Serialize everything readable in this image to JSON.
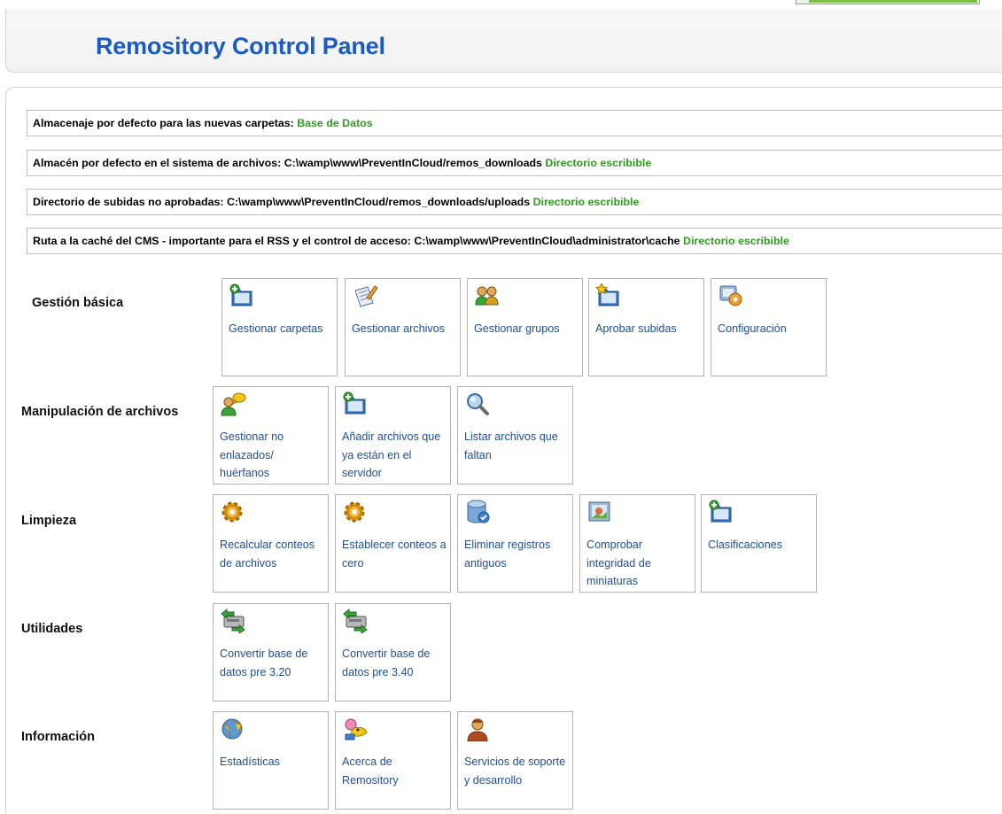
{
  "header": {
    "title": "Remository Control Panel"
  },
  "info": [
    {
      "label": "Almacenaje por defecto para las nuevas carpetas:",
      "value": "Base de Datos",
      "status": ""
    },
    {
      "label": "Almacén por defecto en el sistema de archivos:",
      "value": "C:\\wamp\\www\\PreventInCloud/remos_downloads",
      "status": "Directorio escribible"
    },
    {
      "label": "Directorio de subidas no aprobadas:",
      "value": "C:\\wamp\\www\\PreventInCloud/remos_downloads/uploads",
      "status": "Directorio escribible"
    },
    {
      "label": "Ruta a la caché del CMS - importante para el RSS y el control de acceso:",
      "value": "C:\\wamp\\www\\PreventInCloud\\administrator\\cache",
      "status": "Directorio escribible"
    }
  ],
  "colors": {
    "title": "#1a5cc4",
    "link": "#1f4f99",
    "ok": "#2f9e1f",
    "border": "#b3b3b3"
  },
  "sections": [
    {
      "label": "Gestión básica",
      "items": [
        {
          "label": "Gestionar carpetas",
          "icon": "folder-add-icon"
        },
        {
          "label": "Gestionar archivos",
          "icon": "document-edit-icon"
        },
        {
          "label": "Gestionar grupos",
          "icon": "users-icon"
        },
        {
          "label": "Aprobar subidas",
          "icon": "folder-star-icon"
        },
        {
          "label": "Configuración",
          "icon": "config-icon"
        }
      ]
    },
    {
      "label": "Manipulación de archivos",
      "items": [
        {
          "label": "Gestionar no enlazados/ huérfanos",
          "icon": "user-chat-icon"
        },
        {
          "label": "Añadir archivos que ya están en el servidor",
          "icon": "folder-add-icon"
        },
        {
          "label": "Listar archivos que faltan",
          "icon": "magnifier-icon"
        }
      ]
    },
    {
      "label": "Limpieza",
      "items": [
        {
          "label": "Recalcular conteos de archivos",
          "icon": "gear-icon"
        },
        {
          "label": "Establecer conteos a cero",
          "icon": "gear-icon"
        },
        {
          "label": "Eliminar registros antiguos",
          "icon": "database-icon"
        },
        {
          "label": "Comprobar integridad de miniaturas",
          "icon": "picture-icon"
        },
        {
          "label": "Clasificaciones",
          "icon": "folder-add-icon"
        }
      ]
    },
    {
      "label": "Utilidades",
      "items": [
        {
          "label": "Convertir base de datos pre 3.20",
          "icon": "convert-icon"
        },
        {
          "label": "Convertir base de datos pre 3.40",
          "icon": "convert-icon"
        }
      ]
    },
    {
      "label": "Información",
      "items": [
        {
          "label": "Estadísticas",
          "icon": "globe-icon"
        },
        {
          "label": "Acerca de Remository",
          "icon": "mascot-icon"
        },
        {
          "label": "Servicios de soporte y desarrollo",
          "icon": "support-person-icon"
        }
      ]
    }
  ]
}
